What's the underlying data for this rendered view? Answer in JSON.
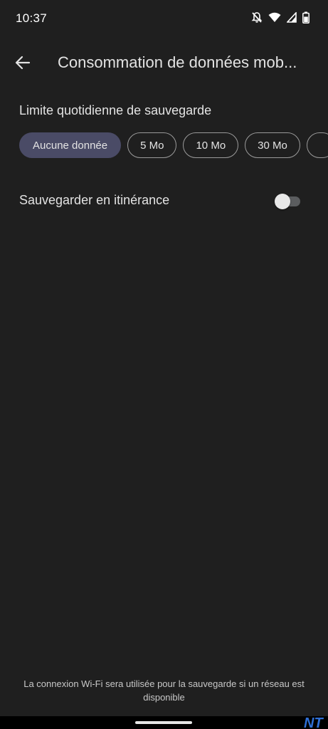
{
  "status_bar": {
    "time": "10:37",
    "icons": [
      "notifications-off-icon",
      "wifi-icon",
      "cellular-signal-icon",
      "battery-icon"
    ]
  },
  "app_bar": {
    "back_icon": "arrow-back-icon",
    "title": "Consommation de données mob..."
  },
  "daily_limit": {
    "title": "Limite quotidienne de sauvegarde",
    "options": [
      "Aucune donnée",
      "5 Mo",
      "10 Mo",
      "30 Mo"
    ],
    "selected": "Aucune donnée"
  },
  "roaming": {
    "label": "Sauvegarder en itinérance",
    "enabled": false
  },
  "footer": {
    "note": "La connexion Wi-Fi sera utilisée pour la sauvegarde si un réseau est disponible"
  },
  "watermark": {
    "text": "NT"
  },
  "colors": {
    "background": "#1f1f1f",
    "selected_chip": "#4a4b66",
    "chip_border": "#9a9a9a",
    "text": "#e3e3e3"
  }
}
